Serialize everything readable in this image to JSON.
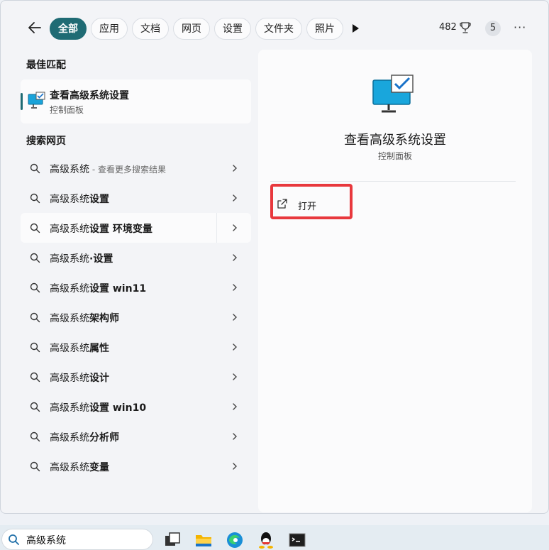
{
  "filters": {
    "tabs": [
      "全部",
      "应用",
      "文档",
      "网页",
      "设置",
      "文件夹",
      "照片"
    ],
    "points": "482",
    "badge": "5",
    "more": "···"
  },
  "best_match": {
    "section_title": "最佳匹配",
    "title": "查看高级系统设置",
    "subtitle": "控制面板"
  },
  "web_search": {
    "section_title": "搜索网页",
    "results": [
      {
        "prefix": "高级系统",
        "bold": "",
        "hint": " - 查看更多搜索结果"
      },
      {
        "prefix": "高级系统",
        "bold": "设置",
        "hint": ""
      },
      {
        "prefix": "高级系统",
        "bold": "设置 环境变量",
        "hint": ""
      },
      {
        "prefix": "高级系统",
        "bold": "·设置",
        "hint": ""
      },
      {
        "prefix": "高级系统",
        "bold": "设置 win11",
        "hint": ""
      },
      {
        "prefix": "高级系统",
        "bold": "架构师",
        "hint": ""
      },
      {
        "prefix": "高级系统",
        "bold": "属性",
        "hint": ""
      },
      {
        "prefix": "高级系统",
        "bold": "设计",
        "hint": ""
      },
      {
        "prefix": "高级系统",
        "bold": "设置 win10",
        "hint": ""
      },
      {
        "prefix": "高级系统",
        "bold": "分析师",
        "hint": ""
      },
      {
        "prefix": "高级系统",
        "bold": "变量",
        "hint": ""
      }
    ]
  },
  "preview": {
    "title": "查看高级系统设置",
    "subtitle": "控制面板",
    "open_label": "打开"
  },
  "taskbar": {
    "search_value": "高级系统"
  },
  "colors": {
    "accent": "#1f6b74",
    "highlight": "#e8383d"
  },
  "icons": [
    "back-arrow-icon",
    "play-icon",
    "trophy-icon",
    "search-icon",
    "chevron-right-icon",
    "external-link-icon",
    "monitor-check-icon"
  ]
}
